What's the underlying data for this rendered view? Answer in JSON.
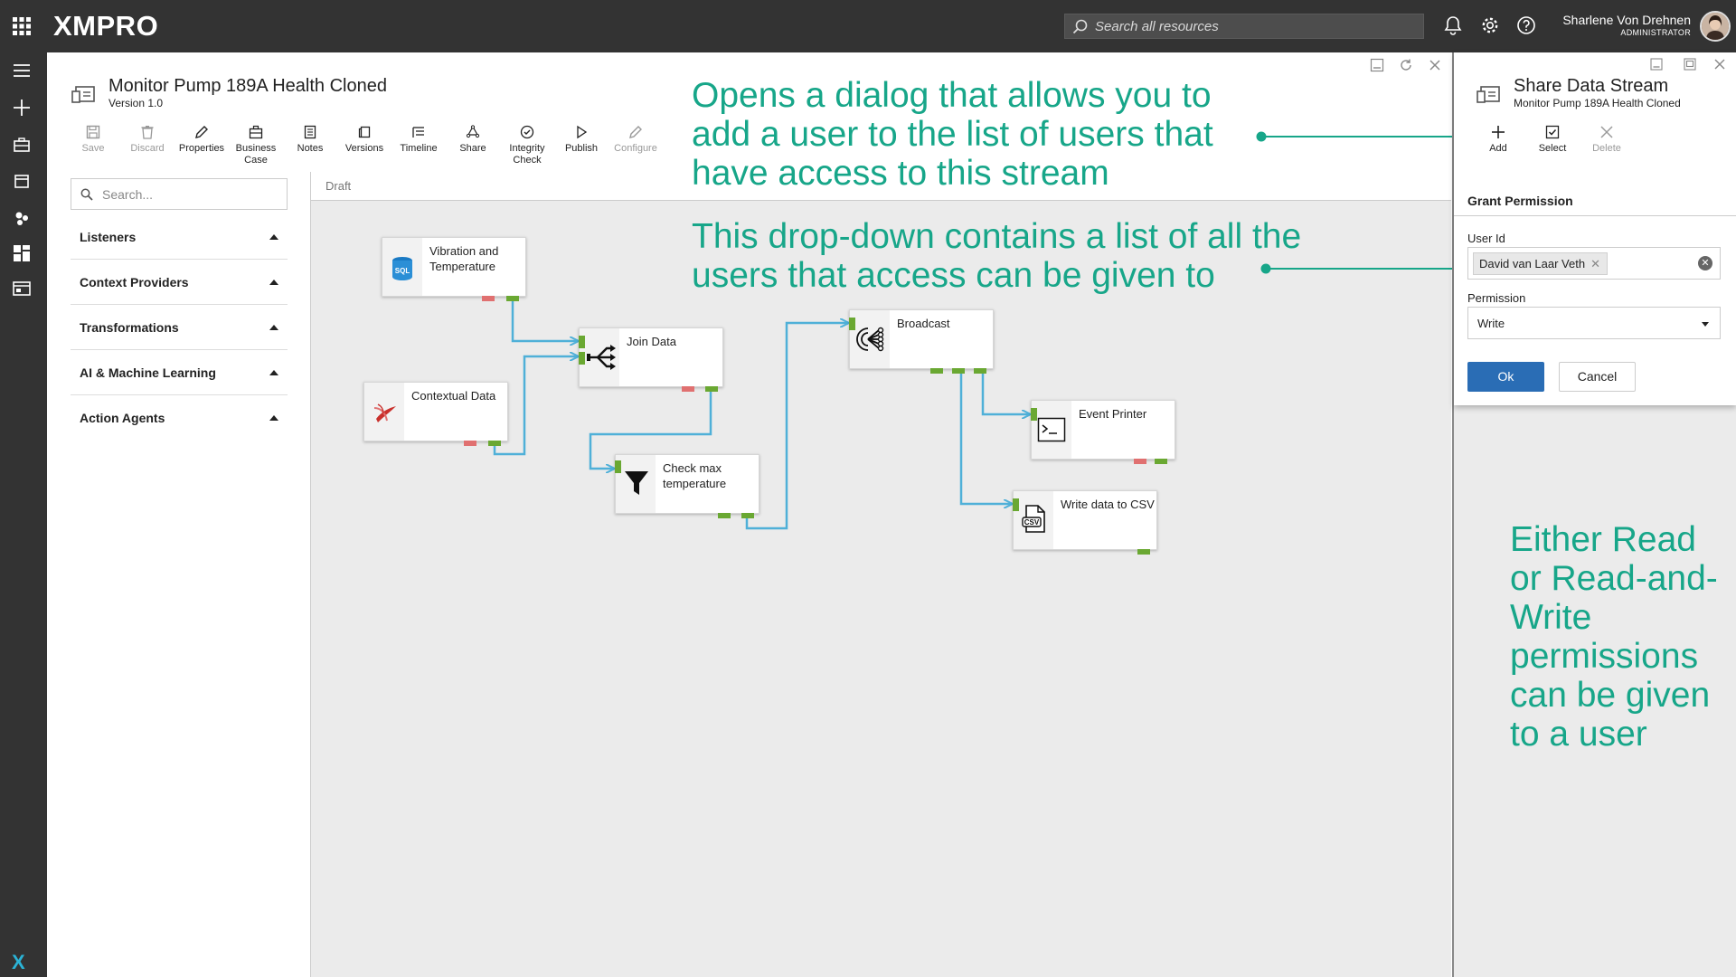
{
  "app": {
    "logo": "XMPRO",
    "search_placeholder": "Search all resources",
    "user_name": "Sharlene Von Drehnen",
    "user_role": "ADMINISTRATOR"
  },
  "designer": {
    "title": "Monitor Pump 189A Health Cloned",
    "version": "Version 1.0",
    "toolbar": [
      {
        "label": "Save",
        "icon": "save-icon",
        "disabled": true
      },
      {
        "label": "Discard",
        "icon": "trash-icon",
        "disabled": true
      },
      {
        "label": "Properties",
        "icon": "pencil-icon",
        "disabled": false
      },
      {
        "label": "Business Case",
        "icon": "briefcase-icon",
        "disabled": false
      },
      {
        "label": "Notes",
        "icon": "notes-icon",
        "disabled": false
      },
      {
        "label": "Versions",
        "icon": "versions-icon",
        "disabled": false
      },
      {
        "label": "Timeline",
        "icon": "timeline-icon",
        "disabled": false
      },
      {
        "label": "Share",
        "icon": "share-icon",
        "disabled": false
      },
      {
        "label": "Integrity Check",
        "icon": "check-circle-icon",
        "disabled": false
      },
      {
        "label": "Publish",
        "icon": "play-icon",
        "disabled": false
      },
      {
        "label": "Configure",
        "icon": "pencil-icon",
        "disabled": true
      }
    ],
    "toolbox_search_placeholder": "Search...",
    "categories": [
      "Listeners",
      "Context Providers",
      "Transformations",
      "AI & Machine Learning",
      "Action Agents"
    ],
    "canvas_status": "Draft",
    "nodes": {
      "vibration": "Vibration and Temperature",
      "contextual": "Contextual Data",
      "join": "Join Data",
      "check": "Check max temperature",
      "broadcast": "Broadcast",
      "printer": "Event Printer",
      "csv": "Write data to CSV"
    }
  },
  "share": {
    "title": "Share Data Stream",
    "subtitle": "Monitor Pump 189A Health Cloned",
    "buttons": [
      {
        "label": "Add",
        "icon": "plus-icon",
        "disabled": false
      },
      {
        "label": "Select",
        "icon": "checkbox-icon",
        "disabled": false
      },
      {
        "label": "Delete",
        "icon": "close-icon",
        "disabled": true
      }
    ],
    "section_title": "Grant Permission",
    "user_id_label": "User Id",
    "user_id_value": "David van Laar Veth",
    "permission_label": "Permission",
    "permission_value": "Write",
    "ok_label": "Ok",
    "cancel_label": "Cancel"
  },
  "annotations": {
    "add_note": "Opens a dialog that allows you to add a user to the list of users that have access to this stream",
    "dropdown_note": "This drop-down contains a list of all the users that access can be given to",
    "permission_note": "Either Read or Read-and-Write permissions can be given to a user",
    "color": "#17a689"
  }
}
